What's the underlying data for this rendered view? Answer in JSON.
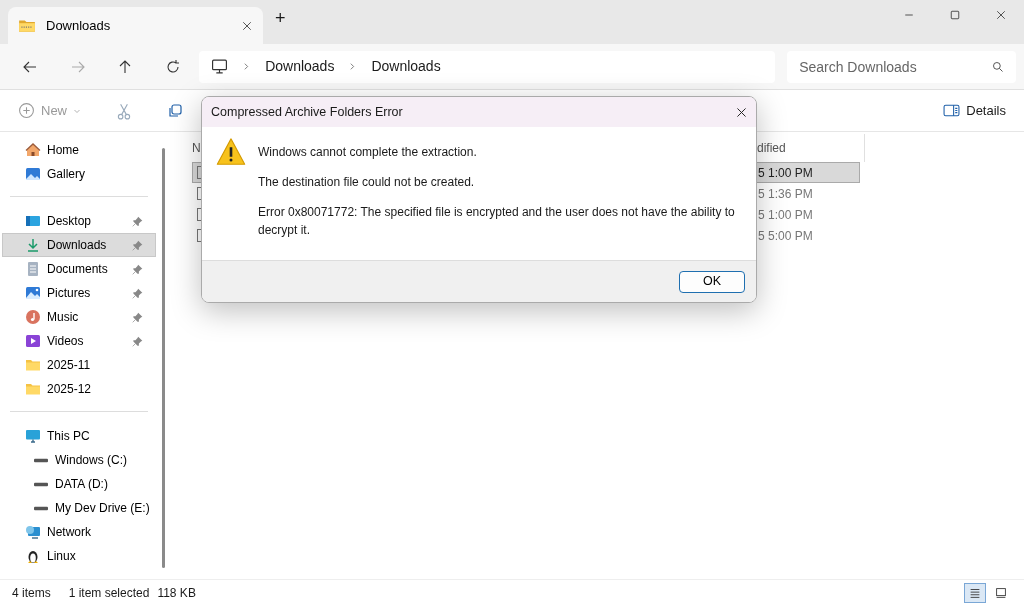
{
  "window": {
    "tab": {
      "title": "Downloads",
      "selected": true
    },
    "new_tab": "+"
  },
  "navigation": {
    "breadcrumb": [
      "Downloads",
      "Downloads"
    ],
    "search": {
      "placeholder": "Search Downloads"
    }
  },
  "toolbar": {
    "new_button": "New",
    "details_button": "Details"
  },
  "sidebar": {
    "groups": [
      [
        {
          "label": "Home",
          "pinned": false,
          "selected": false
        },
        {
          "label": "Gallery",
          "pinned": false,
          "selected": false
        }
      ],
      [
        {
          "label": "Desktop",
          "pinned": true,
          "selected": false
        },
        {
          "label": "Downloads",
          "pinned": true,
          "selected": true
        },
        {
          "label": "Documents",
          "pinned": true,
          "selected": false
        },
        {
          "label": "Pictures",
          "pinned": true,
          "selected": false
        },
        {
          "label": "Music",
          "pinned": true,
          "selected": false
        },
        {
          "label": "Videos",
          "pinned": true,
          "selected": false
        },
        {
          "label": "2025-11",
          "pinned": false,
          "selected": false
        },
        {
          "label": "2025-12",
          "pinned": false,
          "selected": false
        }
      ],
      [
        {
          "label": "This PC",
          "pinned": false,
          "selected": false,
          "children": [
            {
              "label": "Windows (C:)",
              "pinned": false,
              "selected": false
            },
            {
              "label": "DATA (D:)",
              "pinned": false,
              "selected": false
            },
            {
              "label": "My Dev Drive (E:)",
              "pinned": false,
              "selected": false
            }
          ]
        },
        {
          "label": "Network",
          "pinned": false,
          "selected": false
        },
        {
          "label": "Linux",
          "pinned": false,
          "selected": false
        }
      ]
    ]
  },
  "file_list": {
    "columns": [
      "N",
      "dified"
    ],
    "rows": [
      {
        "column_2": "5 1:00 PM",
        "selected": true
      },
      {
        "column_2": "5 1:36 PM",
        "selected": false
      },
      {
        "column_2": "5 1:00 PM",
        "selected": false
      },
      {
        "column_2": "5 5:00 PM",
        "selected": false
      }
    ]
  },
  "dialog": {
    "title": "Compressed Archive Folders Error",
    "messages": [
      "Windows cannot complete the extraction.",
      "The destination file could not be created.",
      "Error 0x80071772: The specified file is encrypted and the user does not have the ability to decrypt it."
    ],
    "button": "OK"
  },
  "status_bar": {
    "items": "4 items",
    "selection": "1 item selected",
    "size": "118 KB",
    "view_buttons": [
      {
        "selected": true
      },
      {
        "selected": false
      }
    ]
  }
}
